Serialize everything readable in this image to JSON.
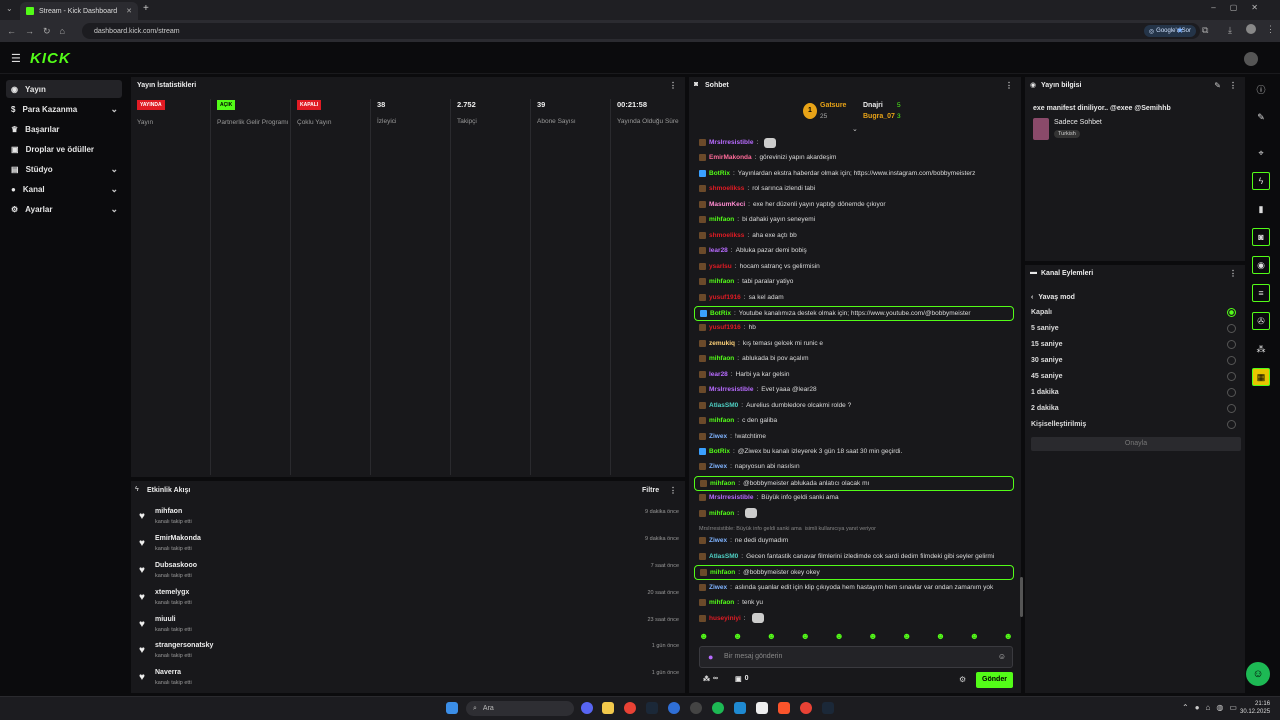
{
  "browser": {
    "tab_title": "Stream - Kick Dashboard",
    "url": "dashboard.kick.com/stream",
    "google_btn": "Google'a Sor"
  },
  "brand": "KICK",
  "sidebar": {
    "items": [
      {
        "label": "Yayın",
        "icon": "broadcast-icon"
      },
      {
        "label": "Para Kazanma",
        "icon": "dollar-icon"
      },
      {
        "label": "Başarılar",
        "icon": "trophy-icon"
      },
      {
        "label": "Droplar ve ödüller",
        "icon": "gift-icon"
      },
      {
        "label": "Stüdyo",
        "icon": "studio-icon"
      },
      {
        "label": "Kanal",
        "icon": "user-icon"
      },
      {
        "label": "Ayarlar",
        "icon": "gear-icon"
      }
    ]
  },
  "stats": {
    "title": "Yayın İstatistikleri",
    "cols": [
      {
        "badge": "YAYINDA",
        "badge_color": "#e01b24",
        "label": "Yayın"
      },
      {
        "badge": "AÇIK",
        "badge_color": "#53fc18",
        "label": "Partnerlik Gelir Programı"
      },
      {
        "badge": "KAPALI",
        "badge_color": "#e01b24",
        "label": "Çoklu Yayın"
      },
      {
        "value": "38",
        "label": "İzleyici"
      },
      {
        "value": "2.752",
        "label": "Takipçi"
      },
      {
        "value": "39",
        "label": "Abone Sayısı"
      },
      {
        "value": "00:21:58",
        "label": "Yayında Olduğu Süre"
      }
    ]
  },
  "activity": {
    "title": "Etkinlik Akışı",
    "filter": "Filtre",
    "items": [
      {
        "name": "mihfaon",
        "sub": "kanalı takip etti",
        "time": "9 dakika önce"
      },
      {
        "name": "EmirMakonda",
        "sub": "kanalı takip etti",
        "time": "9 dakika önce"
      },
      {
        "name": "Dubsaskooo",
        "sub": "kanalı takip etti",
        "time": "7 saat önce"
      },
      {
        "name": "xtemelygx",
        "sub": "kanalı takip etti",
        "time": "20 saat önce"
      },
      {
        "name": "miuuli",
        "sub": "kanalı takip etti",
        "time": "23 saat önce"
      },
      {
        "name": "strangersonatsky",
        "sub": "kanalı takip etti",
        "time": "1 gün önce"
      },
      {
        "name": "Naverra",
        "sub": "kanalı takip etti",
        "time": "1 gün önce"
      }
    ]
  },
  "chat": {
    "title": "Sohbet",
    "top": [
      {
        "name": "Gatsure",
        "count": "25"
      },
      {
        "name": "Dnajri",
        "count": "5"
      },
      {
        "name": "Bugra_07",
        "count": "3"
      }
    ],
    "messages": [
      {
        "user": "MrsIrresistible",
        "color": "#b86bff",
        "text": ""
      },
      {
        "user": "EmirMakonda",
        "color": "#ff6b9a",
        "text": "görevinizi yapın akardeşim"
      },
      {
        "user": "BotRix",
        "color": "#53fc18",
        "text": "Yayınlardan ekstra haberdar olmak için; https://www.instagram.com/bobbymeisterz"
      },
      {
        "user": "shmoelikss",
        "color": "#e01b24",
        "text": "rol sarınca izlendi tabi"
      },
      {
        "user": "MasumKeci",
        "color": "#ff8bd0",
        "text": "exe her düzenli yayın yaptığı dönemde çıkıyor"
      },
      {
        "user": "mihfaon",
        "color": "#53fc18",
        "text": "bi dahaki yayın seneyemi"
      },
      {
        "user": "shmoelikss",
        "color": "#e01b24",
        "text": "aha exe açtı bb"
      },
      {
        "user": "lear28",
        "color": "#b86bff",
        "text": "Abluka pazar demi bobiş"
      },
      {
        "user": "ysarIsu",
        "color": "#e01b24",
        "text": "hocam satranç vs gelirmisin"
      },
      {
        "user": "mihfaon",
        "color": "#53fc18",
        "text": "tabi paralar yatiyo"
      },
      {
        "user": "yusuf1916",
        "color": "#e01b24",
        "text": "sa kel adam"
      },
      {
        "user": "BotRix",
        "color": "#53fc18",
        "text": "Youtube kanalımıza destek olmak için; https://www.youtube.com/@bobbymeister",
        "hl": true
      },
      {
        "user": "yusuf1916",
        "color": "#e01b24",
        "text": "hb"
      },
      {
        "user": "zemukiq",
        "color": "#ffd27a",
        "text": "kış teması gelcek mi runic e"
      },
      {
        "user": "mihfaon",
        "color": "#53fc18",
        "text": "ablukada bi pov açalım"
      },
      {
        "user": "lear28",
        "color": "#b86bff",
        "text": "Harbi ya kar gelsin"
      },
      {
        "user": "MrsIrresistible",
        "color": "#b86bff",
        "text": "Evet yaaa @lear28"
      },
      {
        "user": "AtlasSM0",
        "color": "#4fd1c5",
        "text": "Aurelius dumbledore olcakmi rolde ?"
      },
      {
        "user": "mihfaon",
        "color": "#53fc18",
        "text": "c den galiba"
      },
      {
        "user": "Ziwex",
        "color": "#7fb3ff",
        "text": "!watchtime"
      },
      {
        "user": "BotRix",
        "color": "#53fc18",
        "text": "@Ziwex bu kanalı izleyerek 3 gün 18 saat 30 min geçirdi."
      },
      {
        "user": "Ziwex",
        "color": "#7fb3ff",
        "text": "napıyosun abi nasılsın"
      },
      {
        "user": "mihfaon",
        "color": "#53fc18",
        "text": "@bobbymeister ablukada anlatıcı olacak mı",
        "hl": true
      },
      {
        "user": "MrsIrresistible",
        "color": "#b86bff",
        "text": "Büyük info geldi sanki ama"
      },
      {
        "user": "mihfaon",
        "color": "#53fc18",
        "text": ""
      },
      {
        "user": "Ziwex",
        "color": "#7fb3ff",
        "text": "ne dedi duymadım"
      },
      {
        "user": "AtlasSM0",
        "color": "#4fd1c5",
        "text": "Gecen fantastik canavar filmlerini izledimde cok sardi dedim filmdeki gibi seyler gelirmi"
      },
      {
        "user": "mihfaon",
        "color": "#53fc18",
        "text": "@bobbymeister okey okey",
        "hl": true
      },
      {
        "user": "Ziwex",
        "color": "#7fb3ff",
        "text": "aslında şuanlar edit için klip çıkıyoda hem hastayım hem sınavlar var ondan zamanım yok"
      },
      {
        "user": "mihfaon",
        "color": "#53fc18",
        "text": "tenk yu"
      },
      {
        "user": "huseyiniyi",
        "color": "#e01b24",
        "text": ""
      }
    ],
    "reply_note": "MrsIrresistible: Büyük info geldi sanki ama",
    "reply_note2": "isimli kullanıcıya yanıt veriyor",
    "input_placeholder": "Bir mesaj gönderin",
    "send": "Gönder",
    "points": "∞",
    "gifts": "0"
  },
  "info": {
    "title": "Yayın bilgisi",
    "stream_title": "exe manifest diniliyor.. @exee @Semihhb",
    "category": "Sadece Sohbet",
    "tag": "Turkish"
  },
  "actions": {
    "title": "Kanal Eylemleri",
    "back": "Yavaş mod",
    "options": [
      "Kapalı",
      "5 saniye",
      "15 saniye",
      "30 saniye",
      "45 saniye",
      "1 dakika",
      "2 dakika",
      "Kişiselleştirilmiş"
    ],
    "selected": 0,
    "confirm": "Onayla"
  },
  "taskbar": {
    "search": "Ara",
    "time": "21:16",
    "date": "30.12.2025"
  },
  "colors": {
    "accent": "#53fc18",
    "live": "#e01b24"
  }
}
